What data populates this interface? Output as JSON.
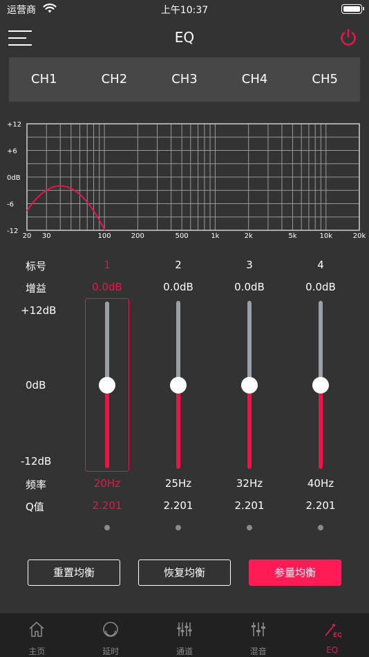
{
  "status": {
    "carrier": "运营商",
    "time": "上午10:37"
  },
  "header": {
    "title": "EQ"
  },
  "tabs": [
    {
      "label": "CH1",
      "active": true
    },
    {
      "label": "CH2",
      "active": false
    },
    {
      "label": "CH3",
      "active": false
    },
    {
      "label": "CH4",
      "active": false
    },
    {
      "label": "CH5",
      "active": false
    }
  ],
  "graph": {
    "y_labels": [
      "+12",
      "+6",
      "0dB",
      "-6",
      "-12"
    ],
    "x_labels": [
      "20",
      "30",
      "100",
      "200",
      "500",
      "1k",
      "2k",
      "5k",
      "10k",
      "20k"
    ],
    "curve_color": "#e8174a"
  },
  "labels": {
    "index": "标号",
    "gain": "增益",
    "freq": "频率",
    "q": "Q值",
    "scale_top": "+12dB",
    "scale_mid": "0dB",
    "scale_bot": "-12dB"
  },
  "bands": [
    {
      "index": "1",
      "gain": "0.0dB",
      "gain_db": 0,
      "freq": "20Hz",
      "q": "2.201",
      "selected": true
    },
    {
      "index": "2",
      "gain": "0.0dB",
      "gain_db": 0,
      "freq": "25Hz",
      "q": "2.201",
      "selected": false
    },
    {
      "index": "3",
      "gain": "0.0dB",
      "gain_db": 0,
      "freq": "32Hz",
      "q": "2.201",
      "selected": false
    },
    {
      "index": "4",
      "gain": "0.0dB",
      "gain_db": 0,
      "freq": "40Hz",
      "q": "2.201",
      "selected": false
    }
  ],
  "buttons": {
    "reset": "重置均衡",
    "restore": "恢复均衡",
    "param": "参量均衡"
  },
  "nav": [
    {
      "label": "主页",
      "icon": "home-icon",
      "active": false
    },
    {
      "label": "延时",
      "icon": "delay-icon",
      "active": false
    },
    {
      "label": "通道",
      "icon": "channel-icon",
      "active": false
    },
    {
      "label": "混音",
      "icon": "mixer-icon",
      "active": false
    },
    {
      "label": "EQ",
      "icon": "eq-icon",
      "active": true
    }
  ],
  "colors": {
    "accent": "#e8174a",
    "button_primary": "#ff1c56",
    "background": "#333333",
    "tab_bg": "#474747",
    "nav_bg": "#212121"
  }
}
